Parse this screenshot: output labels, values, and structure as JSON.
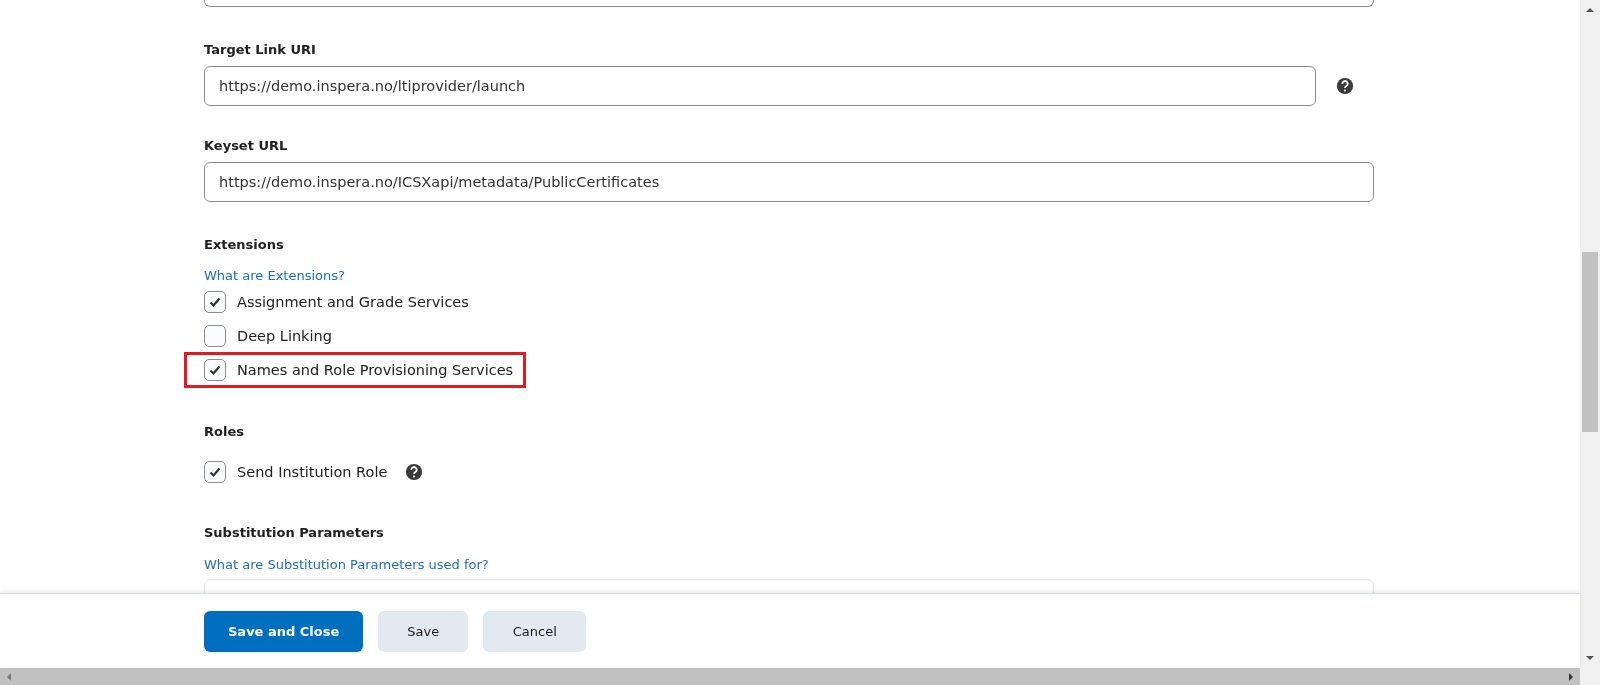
{
  "fields": [
    {
      "kind": "partial"
    },
    {
      "kind": "text",
      "label": "Target Link URI",
      "value": "https://demo.inspera.no/ltiprovider/launch",
      "help": true
    },
    {
      "kind": "text",
      "label": "Keyset URL",
      "value": "https://demo.inspera.no/ICSXapi/metadata/PublicCertificates",
      "help": false
    }
  ],
  "extensions": {
    "label": "Extensions",
    "link": "What are Extensions?",
    "items": [
      {
        "label": "Assignment and Grade Services",
        "checked": true,
        "highlighted": false
      },
      {
        "label": "Deep Linking",
        "checked": false,
        "highlighted": false
      },
      {
        "label": "Names and Role Provisioning Services",
        "checked": true,
        "highlighted": true
      }
    ]
  },
  "roles": {
    "label": "Roles",
    "items": [
      {
        "label": "Send Institution Role",
        "checked": true,
        "help": true
      }
    ]
  },
  "substitution": {
    "label": "Substitution Parameters",
    "link": "What are Substitution Parameters used for?"
  },
  "buttons": [
    {
      "label": "Save and Close",
      "primary": true
    },
    {
      "label": "Save",
      "primary": false
    },
    {
      "label": "Cancel",
      "primary": false
    }
  ]
}
